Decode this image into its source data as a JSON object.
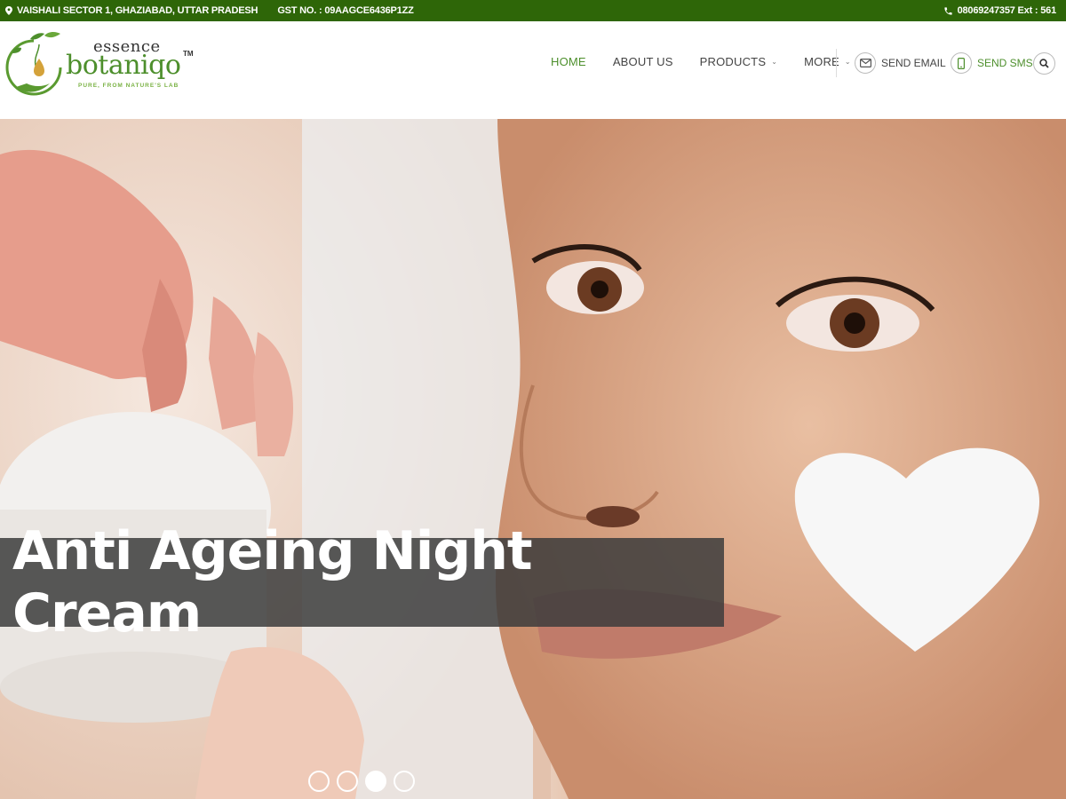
{
  "topbar": {
    "address": "VAISHALI SECTOR 1, GHAZIABAD, UTTAR PRADESH",
    "gst": "GST NO. : 09AAGCE6436P1ZZ",
    "phone": "08069247357 Ext : 561"
  },
  "logo": {
    "line1": "essence",
    "line2": "botaniqo",
    "tm": "TM",
    "tagline": "PURE, FROM NATURE'S LAB"
  },
  "nav": {
    "items": [
      {
        "label": "HOME",
        "active": true
      },
      {
        "label": "ABOUT US"
      },
      {
        "label": "PRODUCTS",
        "dropdown": true
      },
      {
        "label": "MORE",
        "dropdown": true
      }
    ],
    "send_email": "SEND EMAIL",
    "send_sms": "SEND SMS"
  },
  "hero": {
    "caption": "Anti Ageing Night Cream",
    "slides_total": 4,
    "active_slide": 3
  },
  "colors": {
    "brand_green": "#2e6608",
    "accent_green": "#4d8f2c"
  }
}
